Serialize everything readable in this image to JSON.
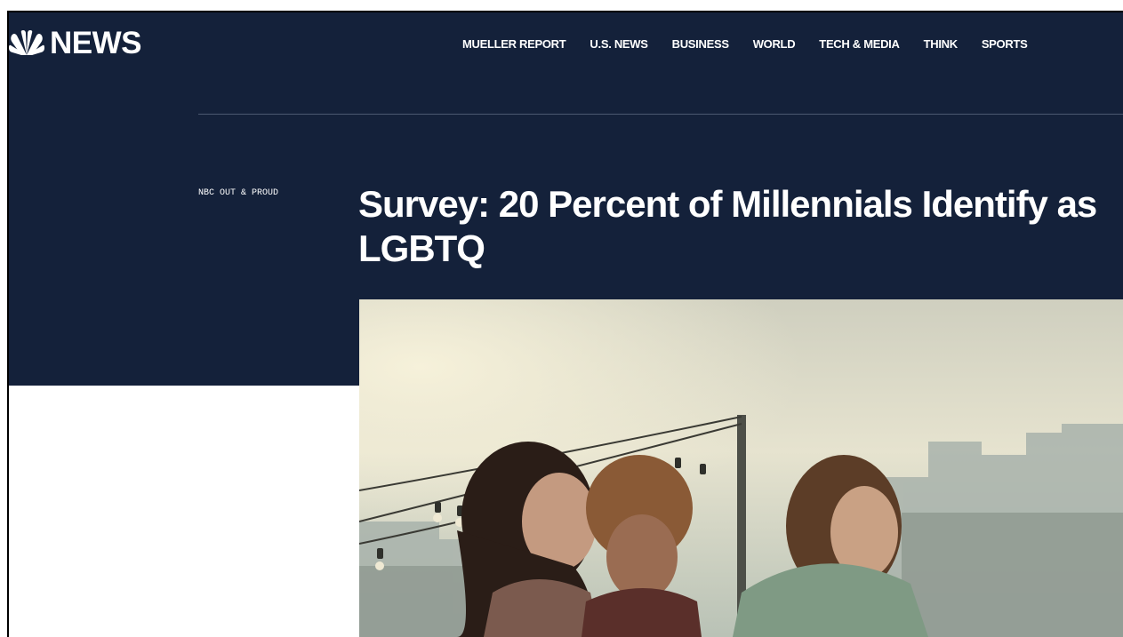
{
  "brand": {
    "logo_text": "NEWS",
    "logo_icon": "nbc-peacock-icon"
  },
  "nav": {
    "items": [
      {
        "label": "MUELLER REPORT"
      },
      {
        "label": "U.S. NEWS"
      },
      {
        "label": "BUSINESS"
      },
      {
        "label": "WORLD"
      },
      {
        "label": "TECH & MEDIA"
      },
      {
        "label": "THINK"
      },
      {
        "label": "SPORTS"
      }
    ]
  },
  "article": {
    "section": "NBC OUT & PROUD",
    "headline": "Survey: 20 Percent of Millennials Identify as LGBTQ"
  },
  "colors": {
    "header_bg": "#14213a",
    "text": "#ffffff"
  }
}
